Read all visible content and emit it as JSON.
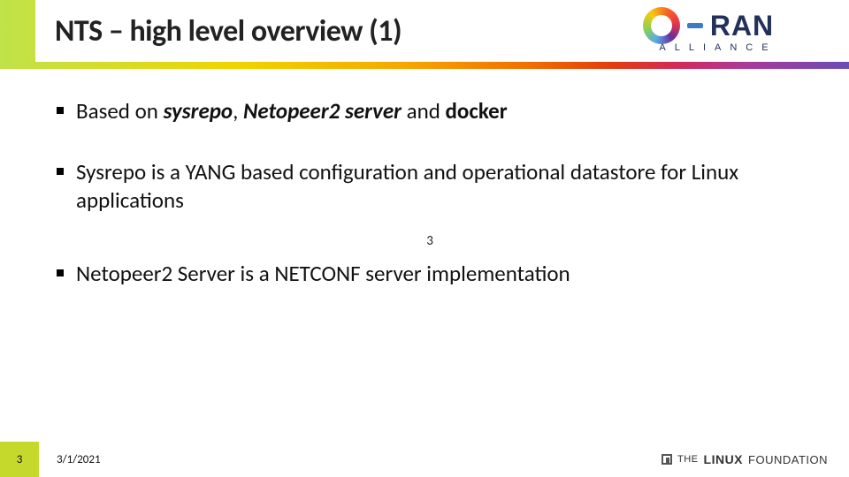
{
  "header": {
    "title": "NTS – high level overview (1)"
  },
  "logo_oran": {
    "ran_text": "RAN",
    "sub_text": "ALLIANCE"
  },
  "bullets": {
    "b1_pre": "Based on ",
    "b1_em1": "sysrepo",
    "b1_mid1": ", ",
    "b1_em2": "Netopeer2 server",
    "b1_mid2": " and ",
    "b1_strong": "docker",
    "b2": "Sysrepo is a YANG based configuration and operational datastore for Linux applications",
    "stray": "3",
    "b3": "Netopeer2 Server is a NETCONF server implementation"
  },
  "footer": {
    "slide_number": "3",
    "date": "3/1/2021",
    "lf_the": "THE",
    "lf_linux": "LINUX",
    "lf_found": "FOUNDATION"
  }
}
